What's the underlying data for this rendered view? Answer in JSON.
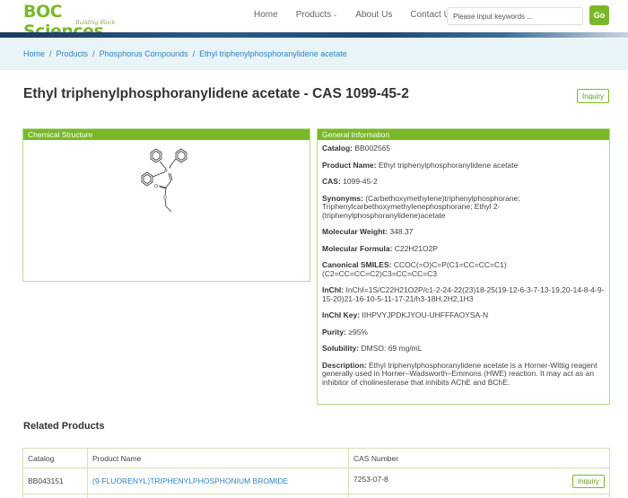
{
  "header": {
    "logo_text": "BOC Sciences",
    "logo_tagline": "Building Block",
    "nav": [
      {
        "label": "Home"
      },
      {
        "label": "Products",
        "dropdown": true
      },
      {
        "label": "About Us"
      },
      {
        "label": "Contact Us"
      }
    ],
    "search_placeholder": "Please input keywords ...",
    "go_label": "Go"
  },
  "breadcrumb": [
    "Home",
    "Products",
    "Phosphorus Compounds",
    "Ethyl triphenylphosphoranylidene acetate"
  ],
  "page_title": "Ethyl triphenylphosphoranylidene acetate - CAS 1099-45-2",
  "inquiry_label": "Inquiry",
  "structure_panel": {
    "title": "Chemical Structure"
  },
  "info_panel": {
    "title": "General Information",
    "fields": [
      {
        "label": "Catalog:",
        "value": "BB002565"
      },
      {
        "label": "Product Name:",
        "value": "Ethyl triphenylphosphoranylidene acetate"
      },
      {
        "label": "CAS:",
        "value": "1099-45-2"
      },
      {
        "label": "Synonyms:",
        "value": "(Carbethoxymethylene)triphenylphosphorane; Triphenylcarbethoxymethylenephosphorane; Ethyl 2-(triphenylphosphoranylidene)acetate"
      },
      {
        "label": "Molecular Weight:",
        "value": "348.37"
      },
      {
        "label": "Molecular Formula:",
        "value": "C22H21O2P"
      },
      {
        "label": "Canonical SMILES:",
        "value": "CCOC(=O)C=P(C1=CC=CC=C1)(C2=CC=CC=C2)C3=CC=CC=C3"
      },
      {
        "label": "InChI:",
        "value": "InChI=1S/C22H21O2P/c1-2-24-22(23)18-25(19-12-6-3-7-13-19,20-14-8-4-9-15-20)21-16-10-5-11-17-21/h3-18H,2H2,1H3"
      },
      {
        "label": "InChI Key:",
        "value": "IIHPVYJPDKJYOU-UHFFFAOYSA-N"
      },
      {
        "label": "Purity:",
        "value": "≥95%"
      },
      {
        "label": "Solubility:",
        "value": "DMSO: 69 mg/mL"
      },
      {
        "label": "Description:",
        "value": "Ethyl triphenylphosphoranylidene acetate is a Horner-Wittig reagent generally used in Horner–Wadsworth–Emmons (HWE) reaction. It may act as an inhibitor of cholinesterase that inhibits AChE and BChE."
      }
    ]
  },
  "related": {
    "title": "Related Products",
    "columns": [
      "Catalog",
      "Product Name",
      "CAS Number"
    ],
    "rows": [
      {
        "catalog": "BB043151",
        "name": "(9-FLUORENYL)TRIPHENYLPHOSPHONIUM BROMIDE",
        "cas": "7253-07-8",
        "action": "Inquiry"
      }
    ]
  },
  "colors": {
    "brand_green": "#7ab829",
    "link_blue": "#2b83c2",
    "breadcrumb_bg": "#e9f4f9"
  }
}
